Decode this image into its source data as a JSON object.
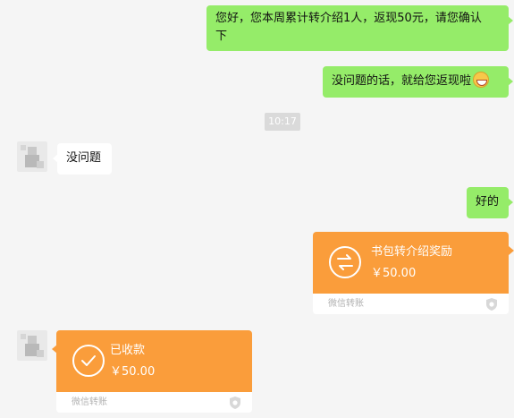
{
  "messages": {
    "m1": "您好，您本周累计转介绍1人，返现50元，请您确认",
    "m1_line2": "下",
    "m2": "没问题的话，就给您返现啦",
    "time": "10:17",
    "m3": "没问题",
    "m4": "好的"
  },
  "transfer_sent": {
    "title": "书包转介绍奖励",
    "amount": "￥50.00",
    "footer": "微信转账"
  },
  "transfer_received": {
    "title": "已收款",
    "amount": "￥50.00",
    "footer": "微信转账"
  },
  "colors": {
    "background": "#f5f5f5",
    "self_bubble": "#95ec69",
    "other_bubble": "#ffffff",
    "transfer_card": "#fa9d3b"
  },
  "icons": {
    "emoji": "grin-emoji-icon",
    "transfer": "transfer-arrows-icon",
    "received": "check-circle-icon",
    "shield": "shield-icon"
  }
}
